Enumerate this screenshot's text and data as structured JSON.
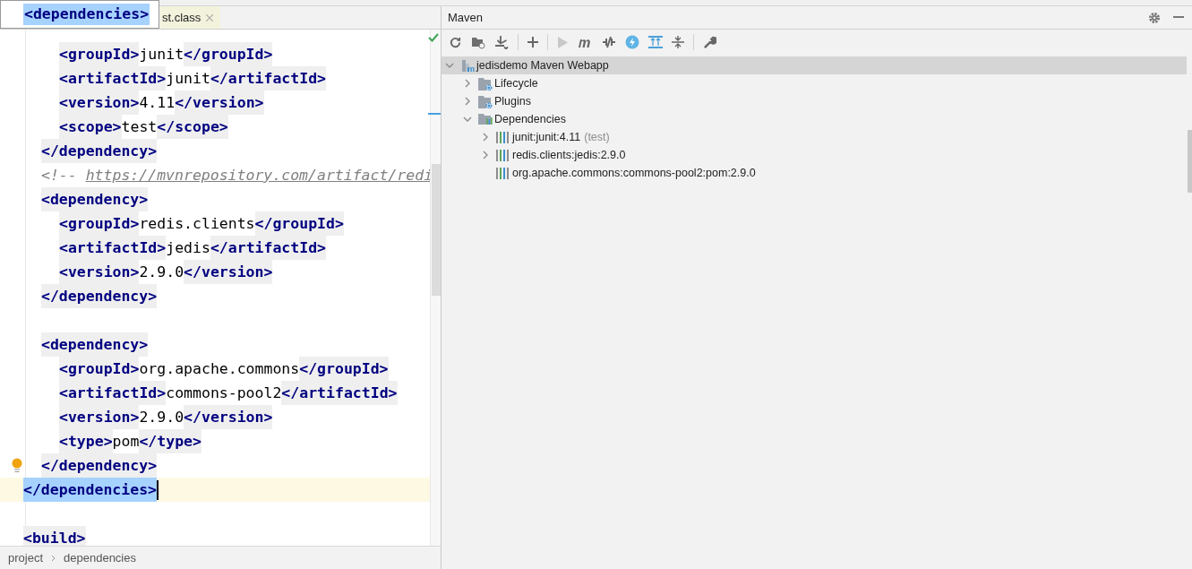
{
  "popup": {
    "text": "<dependencies>"
  },
  "editor_tab": {
    "label": "st.class"
  },
  "code_lines": [
    {
      "children": [
        {
          "children": [
            {
              "current": false,
              "selected": false,
              "hint": false,
              "tokens": [
                {
                  "kind": "tag",
                  "text": "<groupId>"
                },
                {
                  "kind": "text",
                  "text": "junit"
                },
                {
                  "kind": "tag",
                  "text": "</groupId>"
                }
              ]
            },
            {
              "current": false,
              "selected": false,
              "hint": false,
              "tokens": [
                {
                  "kind": "tag",
                  "text": "<artifactId>"
                },
                {
                  "kind": "text",
                  "text": "junit"
                },
                {
                  "kind": "tag",
                  "text": "</artifactId>"
                }
              ]
            },
            {
              "current": false,
              "selected": false,
              "hint": false,
              "tokens": [
                {
                  "kind": "tag",
                  "text": "<version>"
                },
                {
                  "kind": "text",
                  "text": "4.11"
                },
                {
                  "kind": "tag",
                  "text": "</version>"
                }
              ]
            },
            {
              "current": false,
              "selected": false,
              "hint": false,
              "tokens": [
                {
                  "kind": "tag",
                  "text": "<scope>"
                },
                {
                  "kind": "text",
                  "text": "test"
                },
                {
                  "kind": "tag",
                  "text": "</scope>"
                }
              ]
            }
          ]
        },
        {
          "current": false,
          "selected": false,
          "hint": false,
          "tokens": [
            {
              "kind": "tag",
              "text": "</dependency>"
            }
          ]
        },
        {
          "current": false,
          "selected": false,
          "hint": false,
          "tokens": [
            {
              "kind": "comment",
              "text": "<!-- "
            },
            {
              "kind": "link",
              "text": "https://mvnrepository.com/artifact/redi"
            }
          ]
        },
        {
          "current": false,
          "selected": false,
          "hint": false,
          "tokens": [
            {
              "kind": "tag",
              "text": "<dependency>"
            }
          ],
          "children": [
            {
              "current": false,
              "selected": false,
              "hint": false,
              "tokens": [
                {
                  "kind": "tag",
                  "text": "<groupId>"
                },
                {
                  "kind": "text",
                  "text": "redis.clients"
                },
                {
                  "kind": "tag",
                  "text": "</groupId>"
                }
              ]
            },
            {
              "current": false,
              "selected": false,
              "hint": false,
              "tokens": [
                {
                  "kind": "tag",
                  "text": "<artifactId>"
                },
                {
                  "kind": "text",
                  "text": "jedis"
                },
                {
                  "kind": "tag",
                  "text": "</artifactId>"
                }
              ]
            },
            {
              "current": false,
              "selected": false,
              "hint": false,
              "tokens": [
                {
                  "kind": "tag",
                  "text": "<version>"
                },
                {
                  "kind": "text",
                  "text": "2.9.0"
                },
                {
                  "kind": "tag",
                  "text": "</version>"
                }
              ]
            }
          ]
        },
        {
          "current": false,
          "selected": false,
          "hint": false,
          "tokens": [
            {
              "kind": "tag",
              "text": "</dependency>"
            }
          ]
        },
        {
          "current": false,
          "selected": false,
          "hint": false
        },
        {
          "current": false,
          "selected": false,
          "hint": false,
          "tokens": [
            {
              "kind": "tag",
              "text": "<dependency>"
            }
          ],
          "children": [
            {
              "current": false,
              "selected": false,
              "hint": false,
              "tokens": [
                {
                  "kind": "tag",
                  "text": "<groupId>"
                },
                {
                  "kind": "text",
                  "text": "org.apache.commons"
                },
                {
                  "kind": "tag",
                  "text": "</groupId>"
                }
              ]
            },
            {
              "current": false,
              "selected": false,
              "hint": false,
              "tokens": [
                {
                  "kind": "tag",
                  "text": "<artifactId>"
                },
                {
                  "kind": "text",
                  "text": "commons-pool2"
                },
                {
                  "kind": "tag",
                  "text": "</artifactId>"
                }
              ]
            },
            {
              "current": false,
              "selected": false,
              "hint": false,
              "tokens": [
                {
                  "kind": "tag",
                  "text": "<version>"
                },
                {
                  "kind": "text",
                  "text": "2.9.0"
                },
                {
                  "kind": "tag",
                  "text": "</version>"
                }
              ]
            },
            {
              "current": false,
              "selected": false,
              "hint": false,
              "tokens": [
                {
                  "kind": "tag",
                  "text": "<type>"
                },
                {
                  "kind": "text",
                  "text": "pom"
                },
                {
                  "kind": "tag",
                  "text": "</type>"
                }
              ]
            }
          ]
        },
        {
          "current": false,
          "selected": false,
          "hint": true,
          "tokens": [
            {
              "kind": "tag",
              "text": "</dependency>"
            }
          ]
        }
      ]
    },
    {
      "current": true,
      "selected": true,
      "hint": false,
      "tokens": [
        {
          "kind": "tag",
          "text": "</dependencies>"
        }
      ]
    },
    {
      "current": false,
      "selected": false,
      "hint": false
    },
    {
      "current": false,
      "selected": false,
      "hint": false,
      "tokens": [
        {
          "kind": "tag",
          "text": "<build>"
        }
      ]
    }
  ],
  "breadcrumbs": [
    "project",
    "dependencies"
  ],
  "maven": {
    "title": "Maven",
    "tree": [
      {
        "kind": "module",
        "label": "jedisdemo Maven Webapp",
        "selected": true,
        "expanded": true,
        "children": [
          {
            "kind": "lifecycle",
            "label": "Lifecycle",
            "selected": false,
            "expanded": false
          },
          {
            "kind": "plugins",
            "label": "Plugins",
            "selected": false,
            "expanded": false
          },
          {
            "kind": "dependencies",
            "label": "Dependencies",
            "selected": false,
            "expanded": true,
            "children": [
              {
                "kind": "library",
                "label": "junit:junit:4.11",
                "scope": "(test)",
                "selected": false,
                "expanded": false
              },
              {
                "kind": "library",
                "label": "redis.clients:jedis:2.9.0",
                "selected": false,
                "expanded": false
              },
              {
                "kind": "library",
                "label": "org.apache.commons:commons-pool2:pom:2.9.0",
                "selected": false
              }
            ]
          }
        ]
      }
    ]
  }
}
